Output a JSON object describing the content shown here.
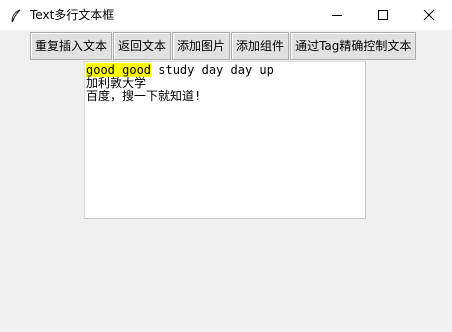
{
  "window": {
    "title": "Text多行文本框"
  },
  "icons": {
    "app": "feather-icon",
    "minimize": "minimize-icon",
    "maximize": "maximize-icon",
    "close": "close-icon"
  },
  "toolbar": {
    "buttons": [
      {
        "label": "重复插入文本"
      },
      {
        "label": "返回文本"
      },
      {
        "label": "添加图片"
      },
      {
        "label": "添加组件"
      },
      {
        "label": "通过Tag精确控制文本"
      }
    ]
  },
  "text_area": {
    "line1_highlight": "good good",
    "line1_rest": " study day day up",
    "line2": "加利敦大学",
    "line3": "百度，搜一下就知道!",
    "highlight_color": "#ffff00"
  }
}
